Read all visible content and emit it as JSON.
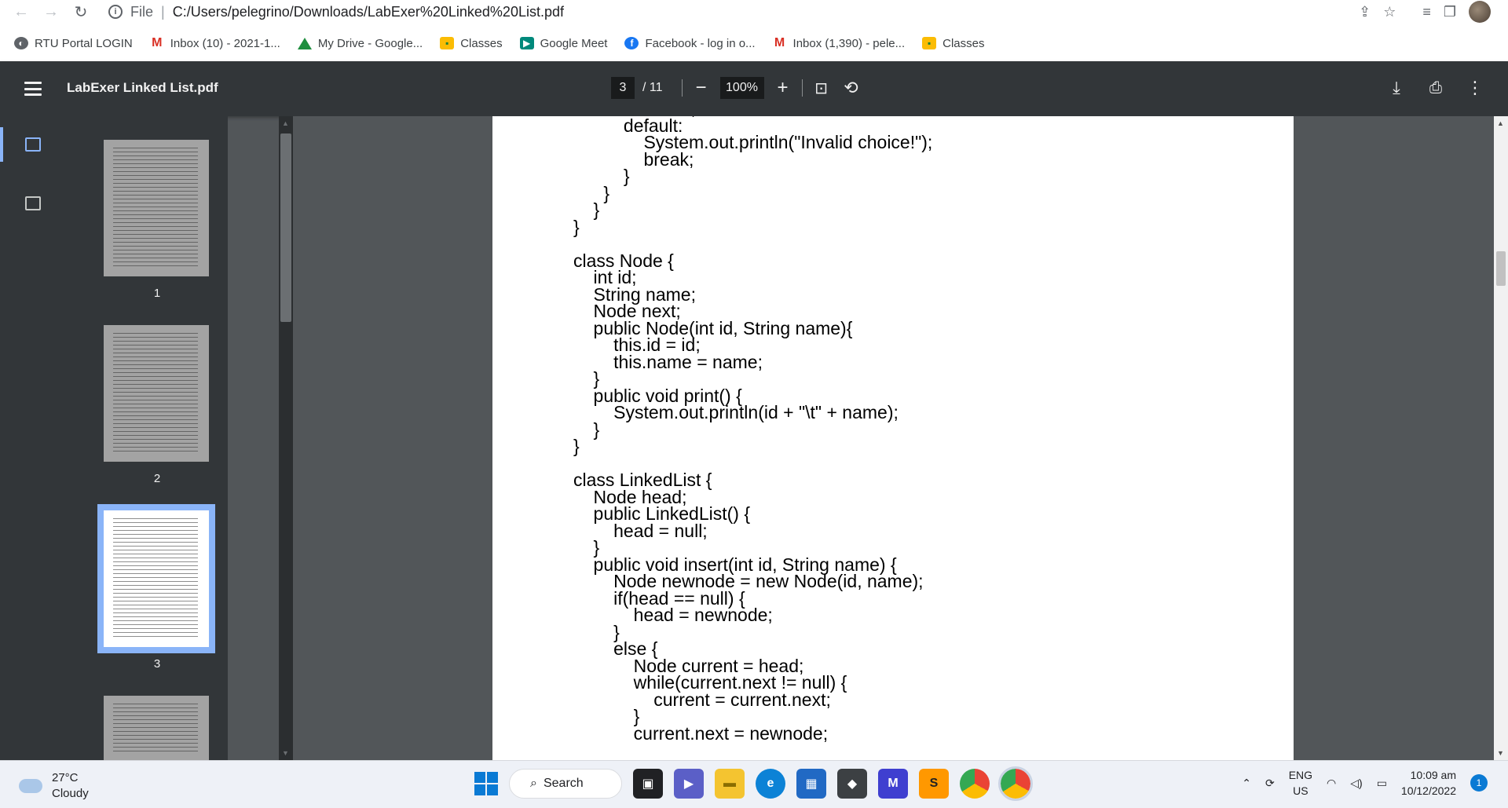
{
  "browser": {
    "url_scheme": "File",
    "url_path": "C:/Users/pelegrino/Downloads/LabExer%20Linked%20List.pdf",
    "bookmarks": [
      {
        "label": "RTU Portal LOGIN",
        "icon": "globe-icon"
      },
      {
        "label": "Inbox (10) - 2021-1...",
        "icon": "gmail-icon"
      },
      {
        "label": "My Drive - Google...",
        "icon": "drive-icon"
      },
      {
        "label": "Classes",
        "icon": "classroom-icon"
      },
      {
        "label": "Google Meet",
        "icon": "meet-icon"
      },
      {
        "label": "Facebook - log in o...",
        "icon": "facebook-icon"
      },
      {
        "label": "Inbox (1,390) - pele...",
        "icon": "gmail-icon"
      },
      {
        "label": "Classes",
        "icon": "classroom-icon"
      }
    ]
  },
  "pdf_toolbar": {
    "title": "LabExer Linked List.pdf",
    "current_page": "3",
    "total_pages": "/ 11",
    "zoom": "100%"
  },
  "sidebar": {
    "pages": [
      {
        "label": "1"
      },
      {
        "label": "2"
      },
      {
        "label": "3"
      }
    ]
  },
  "document": {
    "code": "              return;\n          default:\n              System.out.println(\"Invalid choice!\");\n              break;\n          }\n      }\n    }\n}\n\nclass Node {\n    int id;\n    String name;\n    Node next;\n    public Node(int id, String name){\n        this.id = id;\n        this.name = name;\n    }\n    public void print() {\n        System.out.println(id + \"\\t\" + name);\n    }\n}\n\nclass LinkedList {\n    Node head;\n    public LinkedList() {\n        head = null;\n    }\n    public void insert(int id, String name) {\n        Node newnode = new Node(id, name);\n        if(head == null) {\n            head = newnode;\n        }\n        else {\n            Node current = head;\n            while(current.next != null) {\n                current = current.next;\n            }\n            current.next = newnode;"
  },
  "taskbar": {
    "temperature": "27°C",
    "weather": "Cloudy",
    "search_label": "Search",
    "lang_top": "ENG",
    "lang_bottom": "US",
    "time": "10:09 am",
    "date": "10/12/2022",
    "notification_count": "1"
  }
}
